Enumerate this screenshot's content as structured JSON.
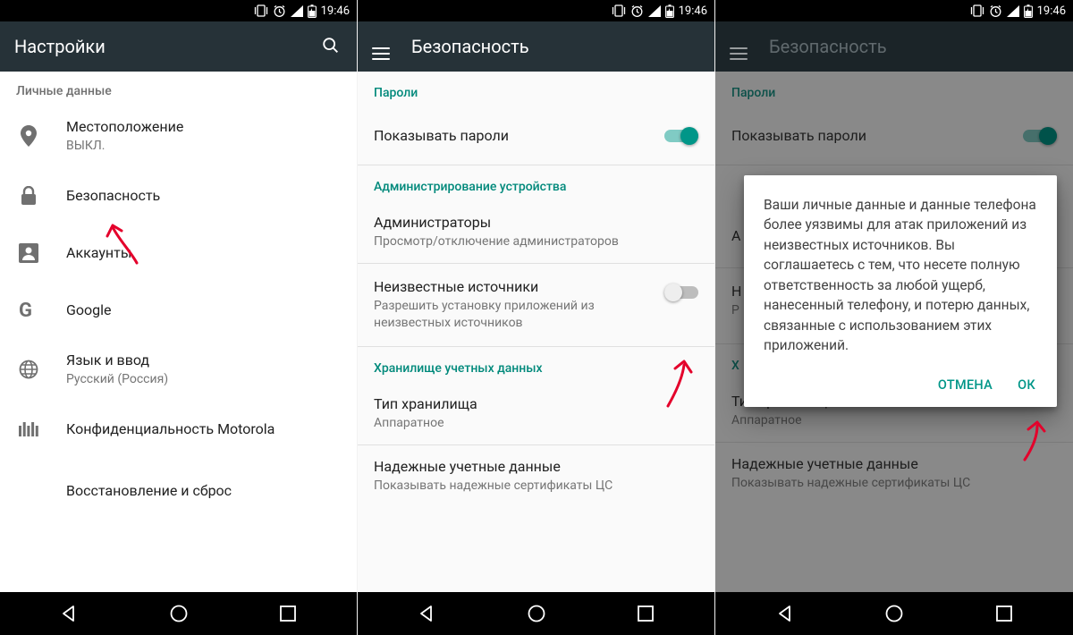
{
  "status": {
    "time": "19:46"
  },
  "screen1": {
    "title": "Настройки",
    "section_personal": "Личные данные",
    "items": [
      {
        "title": "Местоположение",
        "sub": "ВЫКЛ."
      },
      {
        "title": "Безопасность",
        "sub": ""
      },
      {
        "title": "Аккаунты",
        "sub": ""
      },
      {
        "title": "Google",
        "sub": ""
      },
      {
        "title": "Язык и ввод",
        "sub": "Русский (Россия)"
      },
      {
        "title": "Конфиденциальность Motorola",
        "sub": ""
      },
      {
        "title": "Восстановление и сброс",
        "sub": ""
      }
    ]
  },
  "screen2": {
    "title": "Безопасность",
    "sections": {
      "passwords": "Пароли",
      "device_admin": "Администрирование устройства",
      "cred_storage": "Хранилище учетных данных"
    },
    "items": {
      "show_pw": {
        "title": "Показывать пароли"
      },
      "admins": {
        "title": "Администраторы",
        "sub": "Просмотр/отключение администраторов"
      },
      "unknown": {
        "title": "Неизвестные источники",
        "sub": "Разрешить установку приложений из неизвестных источников"
      },
      "storage_type": {
        "title": "Тип хранилища",
        "sub": "Аппаратное"
      },
      "trusted": {
        "title": "Надежные учетные данные",
        "sub": "Показывать надежные сертификаты ЦС"
      }
    }
  },
  "screen3": {
    "title": "Безопасность",
    "dialog": {
      "text": "Ваши личные данные и данные телефона более уязвимы для атак приложений из неизвестных источников. Вы соглашаетесь с тем, что несете полную ответственность за любой ущерб, нанесенный телефону, и потерю данных, связанные с использованием этих приложений.",
      "cancel": "ОТМЕНА",
      "ok": "ОК"
    },
    "items": {
      "show_pw": {
        "title": "Показывать пароли"
      },
      "admins_initial": "А",
      "unknown_n": "Н",
      "unknown_r": "Р",
      "cred_initial": "Х",
      "storage_type": {
        "title": "Тип хранилища",
        "sub": "Аппаратное"
      },
      "trusted": {
        "title": "Надежные учетные данные",
        "sub": "Показывать надежные сертификаты ЦС"
      }
    },
    "sections": {
      "passwords": "Пароли"
    }
  }
}
